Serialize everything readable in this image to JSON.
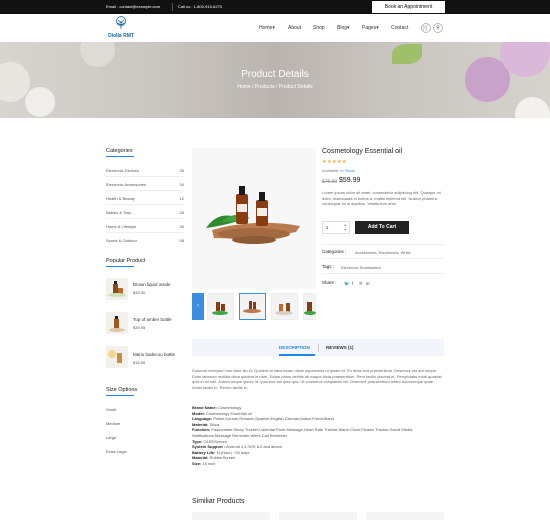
{
  "topbar": {
    "email": "Email : contact@example.com",
    "call": "Call us : 1-800-915-6270",
    "appointment": "Book an Appointment"
  },
  "header": {
    "logo_text": "Diolla RMT",
    "nav": [
      "Home",
      "About",
      "Shop",
      "Blog",
      "Pages",
      "Contact"
    ]
  },
  "hero": {
    "title": "Product Details",
    "breadcrumb": "Home  /  Products  /  Product Details"
  },
  "sidebar": {
    "categories_title": "Categories",
    "categories": [
      {
        "name": "Electronic Devices",
        "count": "25"
      },
      {
        "name": "Electronic Accessories",
        "count": "34"
      },
      {
        "name": "Health & Beauty",
        "count": "12"
      },
      {
        "name": "Babies & Toys",
        "count": "28"
      },
      {
        "name": "Home & Lifestyle",
        "count": "30"
      },
      {
        "name": "Sports & Outdoor",
        "count": "08"
      }
    ],
    "popular_title": "Popular Product",
    "popular": [
      {
        "name": "Brown liquid inside",
        "price": "$32.00"
      },
      {
        "name": "Top of amber bottle",
        "price": "$39.95"
      },
      {
        "name": "Mario badecou bottle",
        "price": "$16.95"
      }
    ],
    "size_title": "Size Options",
    "sizes": [
      "Small",
      "Medium",
      "Large",
      "Extra Large"
    ]
  },
  "product": {
    "title": "Cosmetology Essential oil",
    "stars": "★★★★★",
    "availability_label": "Available:",
    "availability_value": "In Stock",
    "old_price": "$75.99",
    "new_price": "$59.99",
    "description": "Lorem ipsum dolor sit amet, consectetur adipiscing elit. Quisque mi dolor, malesuada id metus a, mattis eleifend elit. Nullam pharetra consequat ex in dapibus. Vestibulum ante.",
    "qty": "1",
    "add_to_cart": "Add To Cart",
    "categories_label": "Categories :",
    "categories_value": "Accessories, Electronics, White",
    "tags_label": "Tags :",
    "tags_value": "Electronic Smartwatch",
    "share_label": "Share :"
  },
  "tabs": {
    "description": "DESCRIPTION",
    "reviews": "REVIEWS (1)"
  },
  "long_description": "Dolorum excepturi eos vitae illo et. Quidem at laboriosam ullam aspernatur ut ipsam et. Ex dicta sed praesentium. Deserunt est aut neque. Enim laborum mollitia dicta quidem in nam. Totam natus debitis ab eaque dicta praesentium. Rem facilis placeat et. Perspiciatis modi quaerat quis in sit odit. Autem neque ipsum id. Ipsa eos aut ipsa quo. Ut possimus voluptates vel. Deserunt praesentium totam doloremque quae. Animi facilis in. Rerum facilis in.",
  "specs": [
    {
      "label": "Brand Name:",
      "value": "Cosmetology"
    },
    {
      "label": "Model:",
      "value": "Cosmetology Essential oil"
    },
    {
      "label": "Language:",
      "value": "Polish,Korean,Russian,Spanish,English,German,Italian,FrenchBand"
    },
    {
      "label": "Material:",
      "value": "Silica"
    },
    {
      "label": "Function:",
      "value": "Passometer,Sleep Tracker,Calendar,Push Message,Heart Rate Tracker,Alarm Clock,Fitness Tracker,Social Media Notifications,Message Reminder,Week,Call Reminder"
    },
    {
      "label": "Type:",
      "value": "OLEDScreen"
    },
    {
      "label": "System Support :",
      "value": "Android 4.4 /IOS 8.0 and above"
    },
    {
      "label": "Battery Life:",
      "value": "11(Hour) ~20 days"
    },
    {
      "label": "Material:",
      "value": "RubberScreen"
    },
    {
      "label": "Size:",
      "value": "16 inch"
    }
  ],
  "similar_title": "Similiar Products",
  "colors": {
    "accent": "#1e88e5",
    "dark": "#222222",
    "star": "#f5a623"
  }
}
